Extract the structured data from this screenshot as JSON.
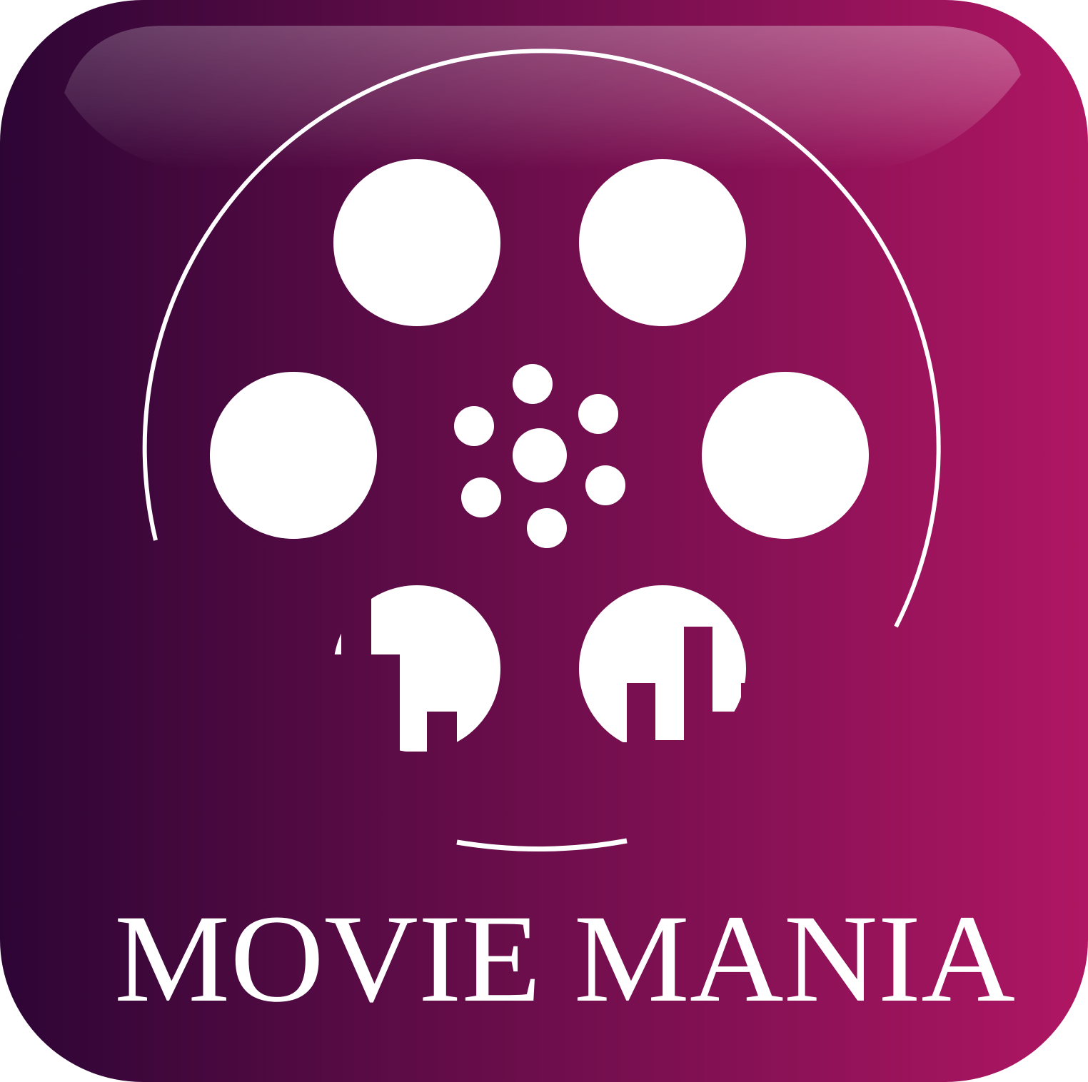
{
  "logo": {
    "brand_name": "MOVIE MANIA",
    "icon": "film-reel-icon",
    "colors": {
      "gradient_start": "#2d0535",
      "gradient_end": "#b01663",
      "foreground": "#ffffff"
    }
  }
}
